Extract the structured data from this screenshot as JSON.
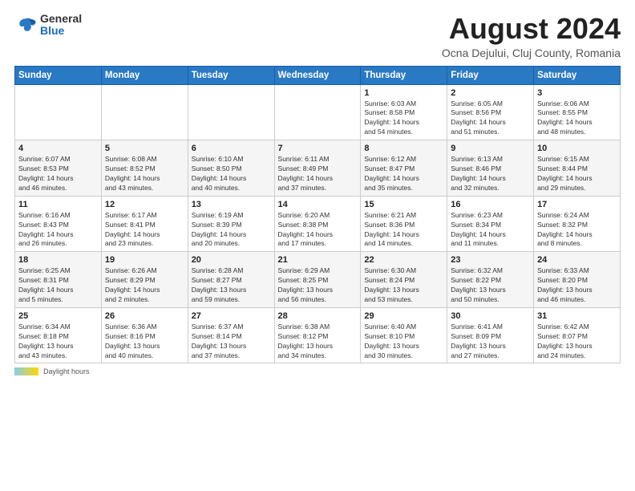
{
  "logo": {
    "general": "General",
    "blue": "Blue"
  },
  "header": {
    "title": "August 2024",
    "subtitle": "Ocna Dejului, Cluj County, Romania"
  },
  "weekdays": [
    "Sunday",
    "Monday",
    "Tuesday",
    "Wednesday",
    "Thursday",
    "Friday",
    "Saturday"
  ],
  "weeks": [
    [
      {
        "day": "",
        "info": ""
      },
      {
        "day": "",
        "info": ""
      },
      {
        "day": "",
        "info": ""
      },
      {
        "day": "",
        "info": ""
      },
      {
        "day": "1",
        "info": "Sunrise: 6:03 AM\nSunset: 8:58 PM\nDaylight: 14 hours\nand 54 minutes."
      },
      {
        "day": "2",
        "info": "Sunrise: 6:05 AM\nSunset: 8:56 PM\nDaylight: 14 hours\nand 51 minutes."
      },
      {
        "day": "3",
        "info": "Sunrise: 6:06 AM\nSunset: 8:55 PM\nDaylight: 14 hours\nand 48 minutes."
      }
    ],
    [
      {
        "day": "4",
        "info": "Sunrise: 6:07 AM\nSunset: 8:53 PM\nDaylight: 14 hours\nand 46 minutes."
      },
      {
        "day": "5",
        "info": "Sunrise: 6:08 AM\nSunset: 8:52 PM\nDaylight: 14 hours\nand 43 minutes."
      },
      {
        "day": "6",
        "info": "Sunrise: 6:10 AM\nSunset: 8:50 PM\nDaylight: 14 hours\nand 40 minutes."
      },
      {
        "day": "7",
        "info": "Sunrise: 6:11 AM\nSunset: 8:49 PM\nDaylight: 14 hours\nand 37 minutes."
      },
      {
        "day": "8",
        "info": "Sunrise: 6:12 AM\nSunset: 8:47 PM\nDaylight: 14 hours\nand 35 minutes."
      },
      {
        "day": "9",
        "info": "Sunrise: 6:13 AM\nSunset: 8:46 PM\nDaylight: 14 hours\nand 32 minutes."
      },
      {
        "day": "10",
        "info": "Sunrise: 6:15 AM\nSunset: 8:44 PM\nDaylight: 14 hours\nand 29 minutes."
      }
    ],
    [
      {
        "day": "11",
        "info": "Sunrise: 6:16 AM\nSunset: 8:43 PM\nDaylight: 14 hours\nand 26 minutes."
      },
      {
        "day": "12",
        "info": "Sunrise: 6:17 AM\nSunset: 8:41 PM\nDaylight: 14 hours\nand 23 minutes."
      },
      {
        "day": "13",
        "info": "Sunrise: 6:19 AM\nSunset: 8:39 PM\nDaylight: 14 hours\nand 20 minutes."
      },
      {
        "day": "14",
        "info": "Sunrise: 6:20 AM\nSunset: 8:38 PM\nDaylight: 14 hours\nand 17 minutes."
      },
      {
        "day": "15",
        "info": "Sunrise: 6:21 AM\nSunset: 8:36 PM\nDaylight: 14 hours\nand 14 minutes."
      },
      {
        "day": "16",
        "info": "Sunrise: 6:23 AM\nSunset: 8:34 PM\nDaylight: 14 hours\nand 11 minutes."
      },
      {
        "day": "17",
        "info": "Sunrise: 6:24 AM\nSunset: 8:32 PM\nDaylight: 14 hours\nand 8 minutes."
      }
    ],
    [
      {
        "day": "18",
        "info": "Sunrise: 6:25 AM\nSunset: 8:31 PM\nDaylight: 14 hours\nand 5 minutes."
      },
      {
        "day": "19",
        "info": "Sunrise: 6:26 AM\nSunset: 8:29 PM\nDaylight: 14 hours\nand 2 minutes."
      },
      {
        "day": "20",
        "info": "Sunrise: 6:28 AM\nSunset: 8:27 PM\nDaylight: 13 hours\nand 59 minutes."
      },
      {
        "day": "21",
        "info": "Sunrise: 6:29 AM\nSunset: 8:25 PM\nDaylight: 13 hours\nand 56 minutes."
      },
      {
        "day": "22",
        "info": "Sunrise: 6:30 AM\nSunset: 8:24 PM\nDaylight: 13 hours\nand 53 minutes."
      },
      {
        "day": "23",
        "info": "Sunrise: 6:32 AM\nSunset: 8:22 PM\nDaylight: 13 hours\nand 50 minutes."
      },
      {
        "day": "24",
        "info": "Sunrise: 6:33 AM\nSunset: 8:20 PM\nDaylight: 13 hours\nand 46 minutes."
      }
    ],
    [
      {
        "day": "25",
        "info": "Sunrise: 6:34 AM\nSunset: 8:18 PM\nDaylight: 13 hours\nand 43 minutes."
      },
      {
        "day": "26",
        "info": "Sunrise: 6:36 AM\nSunset: 8:16 PM\nDaylight: 13 hours\nand 40 minutes."
      },
      {
        "day": "27",
        "info": "Sunrise: 6:37 AM\nSunset: 8:14 PM\nDaylight: 13 hours\nand 37 minutes."
      },
      {
        "day": "28",
        "info": "Sunrise: 6:38 AM\nSunset: 8:12 PM\nDaylight: 13 hours\nand 34 minutes."
      },
      {
        "day": "29",
        "info": "Sunrise: 6:40 AM\nSunset: 8:10 PM\nDaylight: 13 hours\nand 30 minutes."
      },
      {
        "day": "30",
        "info": "Sunrise: 6:41 AM\nSunset: 8:09 PM\nDaylight: 13 hours\nand 27 minutes."
      },
      {
        "day": "31",
        "info": "Sunrise: 6:42 AM\nSunset: 8:07 PM\nDaylight: 13 hours\nand 24 minutes."
      }
    ]
  ],
  "legend": {
    "daylight_label": "Daylight hours"
  }
}
